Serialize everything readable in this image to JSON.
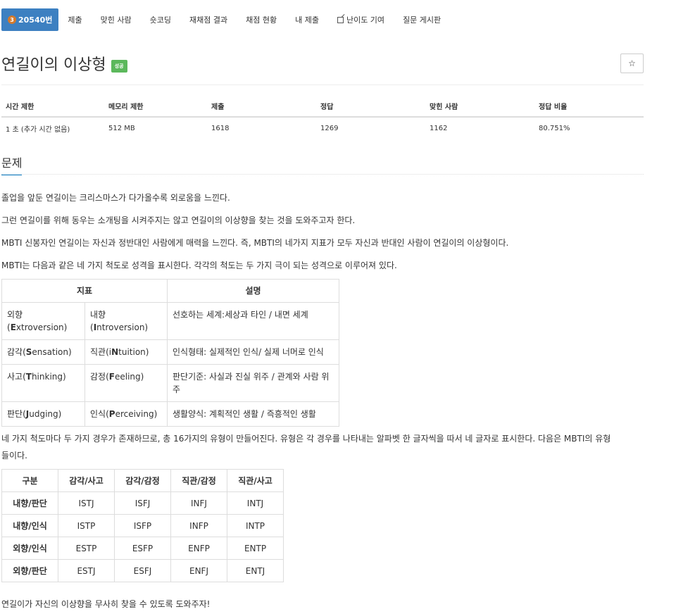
{
  "tabs": {
    "problem_tier": "3",
    "problem_number": "20540번",
    "submit": "제출",
    "solved_users": "맞힌 사람",
    "shortest": "숏코딩",
    "rejudge": "재채점 결과",
    "status": "채점 현황",
    "my_submissions": "내 제출",
    "difficulty": "난이도 기여",
    "board": "질문 게시판"
  },
  "problem": {
    "title": "연길이의 이상형",
    "badge": "성공",
    "star": "☆"
  },
  "info": {
    "headers": [
      "시간 제한",
      "메모리 제한",
      "제출",
      "정답",
      "맞힌 사람",
      "정답 비율"
    ],
    "values": [
      "1 초 (추가 시간 없음)",
      "512 MB",
      "1618",
      "1269",
      "1162",
      "80.751%"
    ]
  },
  "section": {
    "title": "문제"
  },
  "paragraphs": {
    "p1": "졸업을 앞둔 연길이는 크리스마스가 다가올수록 외로움을 느낀다.",
    "p2": "그런 연길이를 위해 동우는 소개팅을 시켜주지는 않고 연길이의 이상향을 찾는 것을 도와주고자 한다.",
    "p3": "MBTI 신봉자인 연길이는 자신과 정반대인 사람에게 매력을 느낀다. 즉, MBTI의 네가지 지표가 모두 자신과 반대인 사람이 연길이의 이상형이다.",
    "p4": "MBTI는 다음과 같은 네 가지 척도로 성격을 표시한다. 각각의 척도는 두 가지 극이 되는 성격으로 이루어져 있다.",
    "p5a": "네 가지 척도마다 두 가지 경우가 존재하므로, 총 16가지의 유형이 만들어진다. 유형은 각 경우를 나타내는 알파벳 한 글자씩을 따서 네 글자로 표시한다. 다음은 MBTI의 유형",
    "p5b": "들이다.",
    "p6": "연길이가 자신의 이상향을 무사히 찾을 수 있도록 도와주자!"
  },
  "table1": {
    "header_indicator": "지표",
    "header_desc": "설명",
    "rows": [
      {
        "a_pre": "외향",
        "a_paren_open": "(",
        "a_bold": "E",
        "a_rest": "xtroversion)",
        "b_pre": "내향",
        "b_paren_open": "(",
        "b_bold": "I",
        "b_rest": "ntroversion)",
        "desc": "선호하는 세계:세상과 타인 / 내면 세계"
      },
      {
        "a_pre": "감각(",
        "a_bold": "S",
        "a_rest": "ensation)",
        "b_pre": "직관(i",
        "b_bold": "N",
        "b_rest": "tuition)",
        "desc": "인식형태: 실제적인 인식/ 실제 너머로 인식"
      },
      {
        "a_pre": "사고(",
        "a_bold": "T",
        "a_rest": "hinking)",
        "b_pre": "감정(",
        "b_bold": "F",
        "b_rest": "eeling)",
        "desc": "판단기준: 사실과 진실 위주 / 관계와 사람 위주"
      },
      {
        "a_pre": "판단(",
        "a_bold": "J",
        "a_rest": "udging)",
        "b_pre": "인식(",
        "b_bold": "P",
        "b_rest": "erceiving)",
        "desc": "생활양식: 계획적인 생활 / 즉흥적인 생활"
      }
    ]
  },
  "table2": {
    "headers": [
      "구분",
      "감각/사고",
      "감각/감정",
      "직관/감정",
      "직관/사고"
    ],
    "rows": [
      {
        "label": "내향/판단",
        "cells": [
          "ISTJ",
          "ISFJ",
          "INFJ",
          "INTJ"
        ]
      },
      {
        "label": "내향/인식",
        "cells": [
          "ISTP",
          "ISFP",
          "INFP",
          "INTP"
        ]
      },
      {
        "label": "외향/인식",
        "cells": [
          "ESTP",
          "ESFP",
          "ENFP",
          "ENTP"
        ]
      },
      {
        "label": "외향/판단",
        "cells": [
          "ESTJ",
          "ESFJ",
          "ENFJ",
          "ENTJ"
        ]
      }
    ]
  }
}
